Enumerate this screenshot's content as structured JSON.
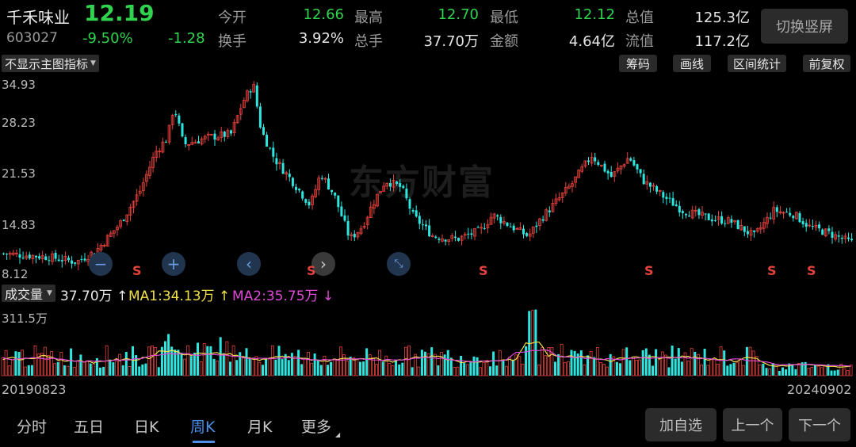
{
  "header": {
    "name": "千禾味业",
    "code": "603027",
    "price": "12.19",
    "change_pct": "-9.50%",
    "change": "-1.28",
    "quote": [
      {
        "label": "今开",
        "value": "12.66",
        "color": "green"
      },
      {
        "label": "最高",
        "value": "12.70",
        "color": "green"
      },
      {
        "label": "最低",
        "value": "12.12",
        "color": "green"
      },
      {
        "label": "总值",
        "value": "125.3亿",
        "color": "white"
      },
      {
        "label": "换手",
        "value": "3.92%",
        "color": "white"
      },
      {
        "label": "总手",
        "value": "37.70万",
        "color": "white"
      },
      {
        "label": "金额",
        "value": "4.64亿",
        "color": "white"
      },
      {
        "label": "流值",
        "value": "117.2亿",
        "color": "white"
      }
    ],
    "switch_label": "切换竖屏"
  },
  "toolbar": {
    "indicator": "不显示主图指标",
    "buttons": [
      "筹码",
      "画线",
      "区间统计",
      "前复权"
    ]
  },
  "main_chart": {
    "price_labels": [
      "34.93",
      "28.23",
      "21.53",
      "14.83",
      "8.12"
    ],
    "watermark": "东方财富",
    "s_marks": [
      "S",
      "S",
      "S",
      "S",
      "S",
      "S"
    ],
    "nav_icons": [
      "zoom-out",
      "zoom-in",
      "scroll-left",
      "scroll-right",
      "collapse"
    ]
  },
  "volume": {
    "selector": "成交量",
    "current": "37.70万",
    "ma1": "MA1:34.13万",
    "ma2": "MA2:35.75万",
    "max_label": "311.5万"
  },
  "dates": {
    "start": "20190823",
    "end": "20240902"
  },
  "bottom": {
    "tabs": [
      "分时",
      "五日",
      "日K",
      "周K",
      "月K",
      "更多"
    ],
    "active_tab": "周K",
    "actions": [
      "加自选",
      "上一个",
      "下一个"
    ]
  },
  "colors": {
    "up": "#e5423c",
    "down": "#2ee6e0",
    "accent": "#4b8fe8",
    "price_down": "#2fd34d",
    "ma1": "#f2e04a",
    "ma2": "#e04ad8"
  }
}
